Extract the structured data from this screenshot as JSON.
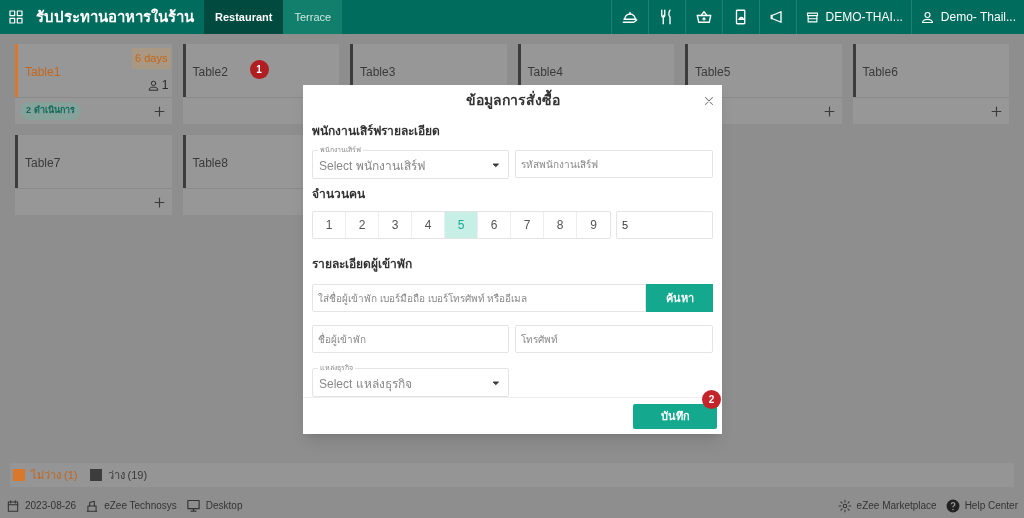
{
  "header": {
    "title": "รับประทานอาหารในร้าน",
    "tabs": [
      {
        "label": "Restaurant",
        "selected": true
      },
      {
        "label": "Terrace",
        "selected": false
      }
    ],
    "property": "DEMO-THAI...",
    "user": "Demo- Thail..."
  },
  "tables": [
    {
      "name": "Table1",
      "occupied": true,
      "duration": "6 days",
      "guests": "1",
      "status": "2 ดำเนินการ"
    },
    {
      "name": "Table2",
      "occupied": false,
      "marker": "1"
    },
    {
      "name": "Table3",
      "occupied": false
    },
    {
      "name": "Table4",
      "occupied": false
    },
    {
      "name": "Table5",
      "occupied": false
    },
    {
      "name": "Table6",
      "occupied": false
    },
    {
      "name": "Table7",
      "occupied": false
    },
    {
      "name": "Table8",
      "occupied": false
    }
  ],
  "legend": [
    {
      "label": "ไม่ว่าง (1)",
      "color": "#d9782a"
    },
    {
      "label": "ว่าง (19)",
      "color": "#3c3c3c"
    }
  ],
  "footer": {
    "date": "2023-08-26",
    "company": "eZee Technosys",
    "device": "Desktop",
    "marketplace": "eZee Marketplace",
    "help": "Help Center"
  },
  "modal": {
    "title": "ข้อมูลการสั่งซื้อ",
    "waiter_heading": "พนักงานเสิร์ฟรายละเอียด",
    "waiter_label": "พนักงานเสิร์ฟ",
    "waiter_select": "Select พนักงานเสิร์ฟ",
    "waiter_code_placeholder": "รหัสพนักงานเสิร์ฟ",
    "pax_heading": "จำนวนคน",
    "pax": [
      {
        "label": "1",
        "selected": false
      },
      {
        "label": "2",
        "selected": false
      },
      {
        "label": "3",
        "selected": false
      },
      {
        "label": "4",
        "selected": false
      },
      {
        "label": "5",
        "selected": true
      },
      {
        "label": "6",
        "selected": false
      },
      {
        "label": "7",
        "selected": false
      },
      {
        "label": "8",
        "selected": false
      },
      {
        "label": "9",
        "selected": false
      }
    ],
    "pax_value": "5",
    "guest_heading": "รายละเอียดผู้เข้าพัก",
    "search_placeholder": "ใส่ชื่อผู้เข้าพัก เบอร์มือถือ เบอร์โทรศัพท์ หรืออีเมล",
    "search_button": "ค้นหา",
    "guest_name_placeholder": "ชื่อผู้เข้าพัก",
    "phone_placeholder": "โทรศัพท์",
    "business_label": "แหล่งธุรกิจ",
    "business_select": "Select แหล่งธุรกิจ",
    "save_button": "บันทึก",
    "save_marker": "2"
  }
}
